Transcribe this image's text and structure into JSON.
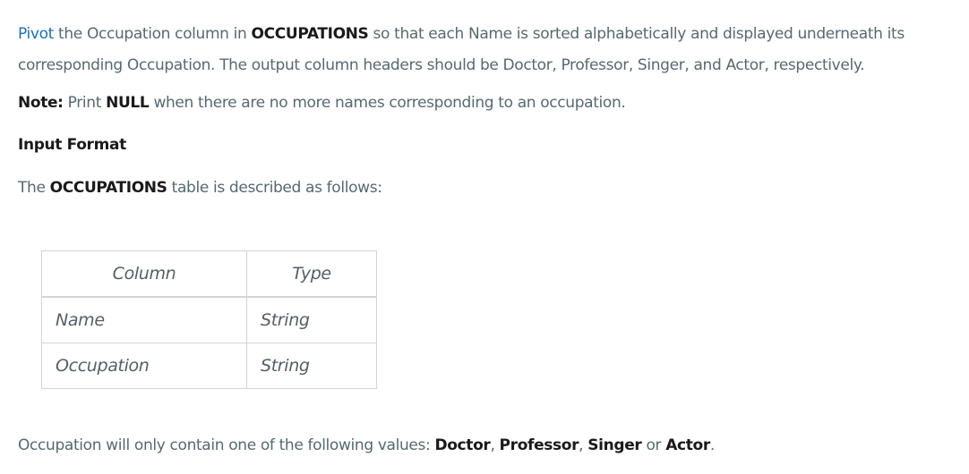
{
  "paragraph1": {
    "link": "Pivot",
    "part1": " the Occupation column in ",
    "bold1": "OCCUPATIONS",
    "part2": " so that each Name is sorted alphabetically and displayed underneath its",
    "line2": "corresponding Occupation. The output column headers should be Doctor, Professor, Singer, and Actor, respectively."
  },
  "note": {
    "label": "Note:",
    "part1": " Print ",
    "bold": "NULL",
    "part2": " when there are no more names corresponding to an occupation."
  },
  "input_format": {
    "heading": "Input Format",
    "part1": "The ",
    "bold": "OCCUPATIONS",
    "part2": " table is described as follows:"
  },
  "schema_table": {
    "headers": [
      "Column",
      "Type"
    ],
    "rows": [
      [
        "Name",
        "String"
      ],
      [
        "Occupation",
        "String"
      ]
    ]
  },
  "footer": {
    "part1": "Occupation will only contain one of the following values: ",
    "v1": "Doctor",
    "sep1": ", ",
    "v2": "Professor",
    "sep2": ", ",
    "v3": "Singer",
    "sep3": " or ",
    "v4": "Actor",
    "end": "."
  }
}
